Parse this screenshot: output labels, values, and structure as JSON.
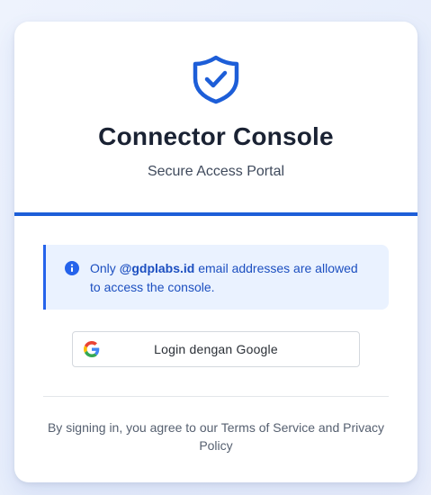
{
  "header": {
    "title": "Connector Console",
    "subtitle": "Secure Access Portal",
    "icon": "shield-check-icon"
  },
  "notice": {
    "icon": "info-icon",
    "prefix": "Only ",
    "domain": "@gdplabs.id",
    "suffix": " email addresses are allowed to access the console."
  },
  "login": {
    "icon": "google-icon",
    "label": "Login dengan Google"
  },
  "footer": {
    "prefix": "By signing in, you agree to our ",
    "terms_link": "Terms of Service",
    "conjunction": " and ",
    "privacy_link": "Privacy Policy"
  },
  "colors": {
    "accent": "#1d5ed8",
    "notice_bg": "#eaf2ff",
    "title": "#1a2233"
  }
}
